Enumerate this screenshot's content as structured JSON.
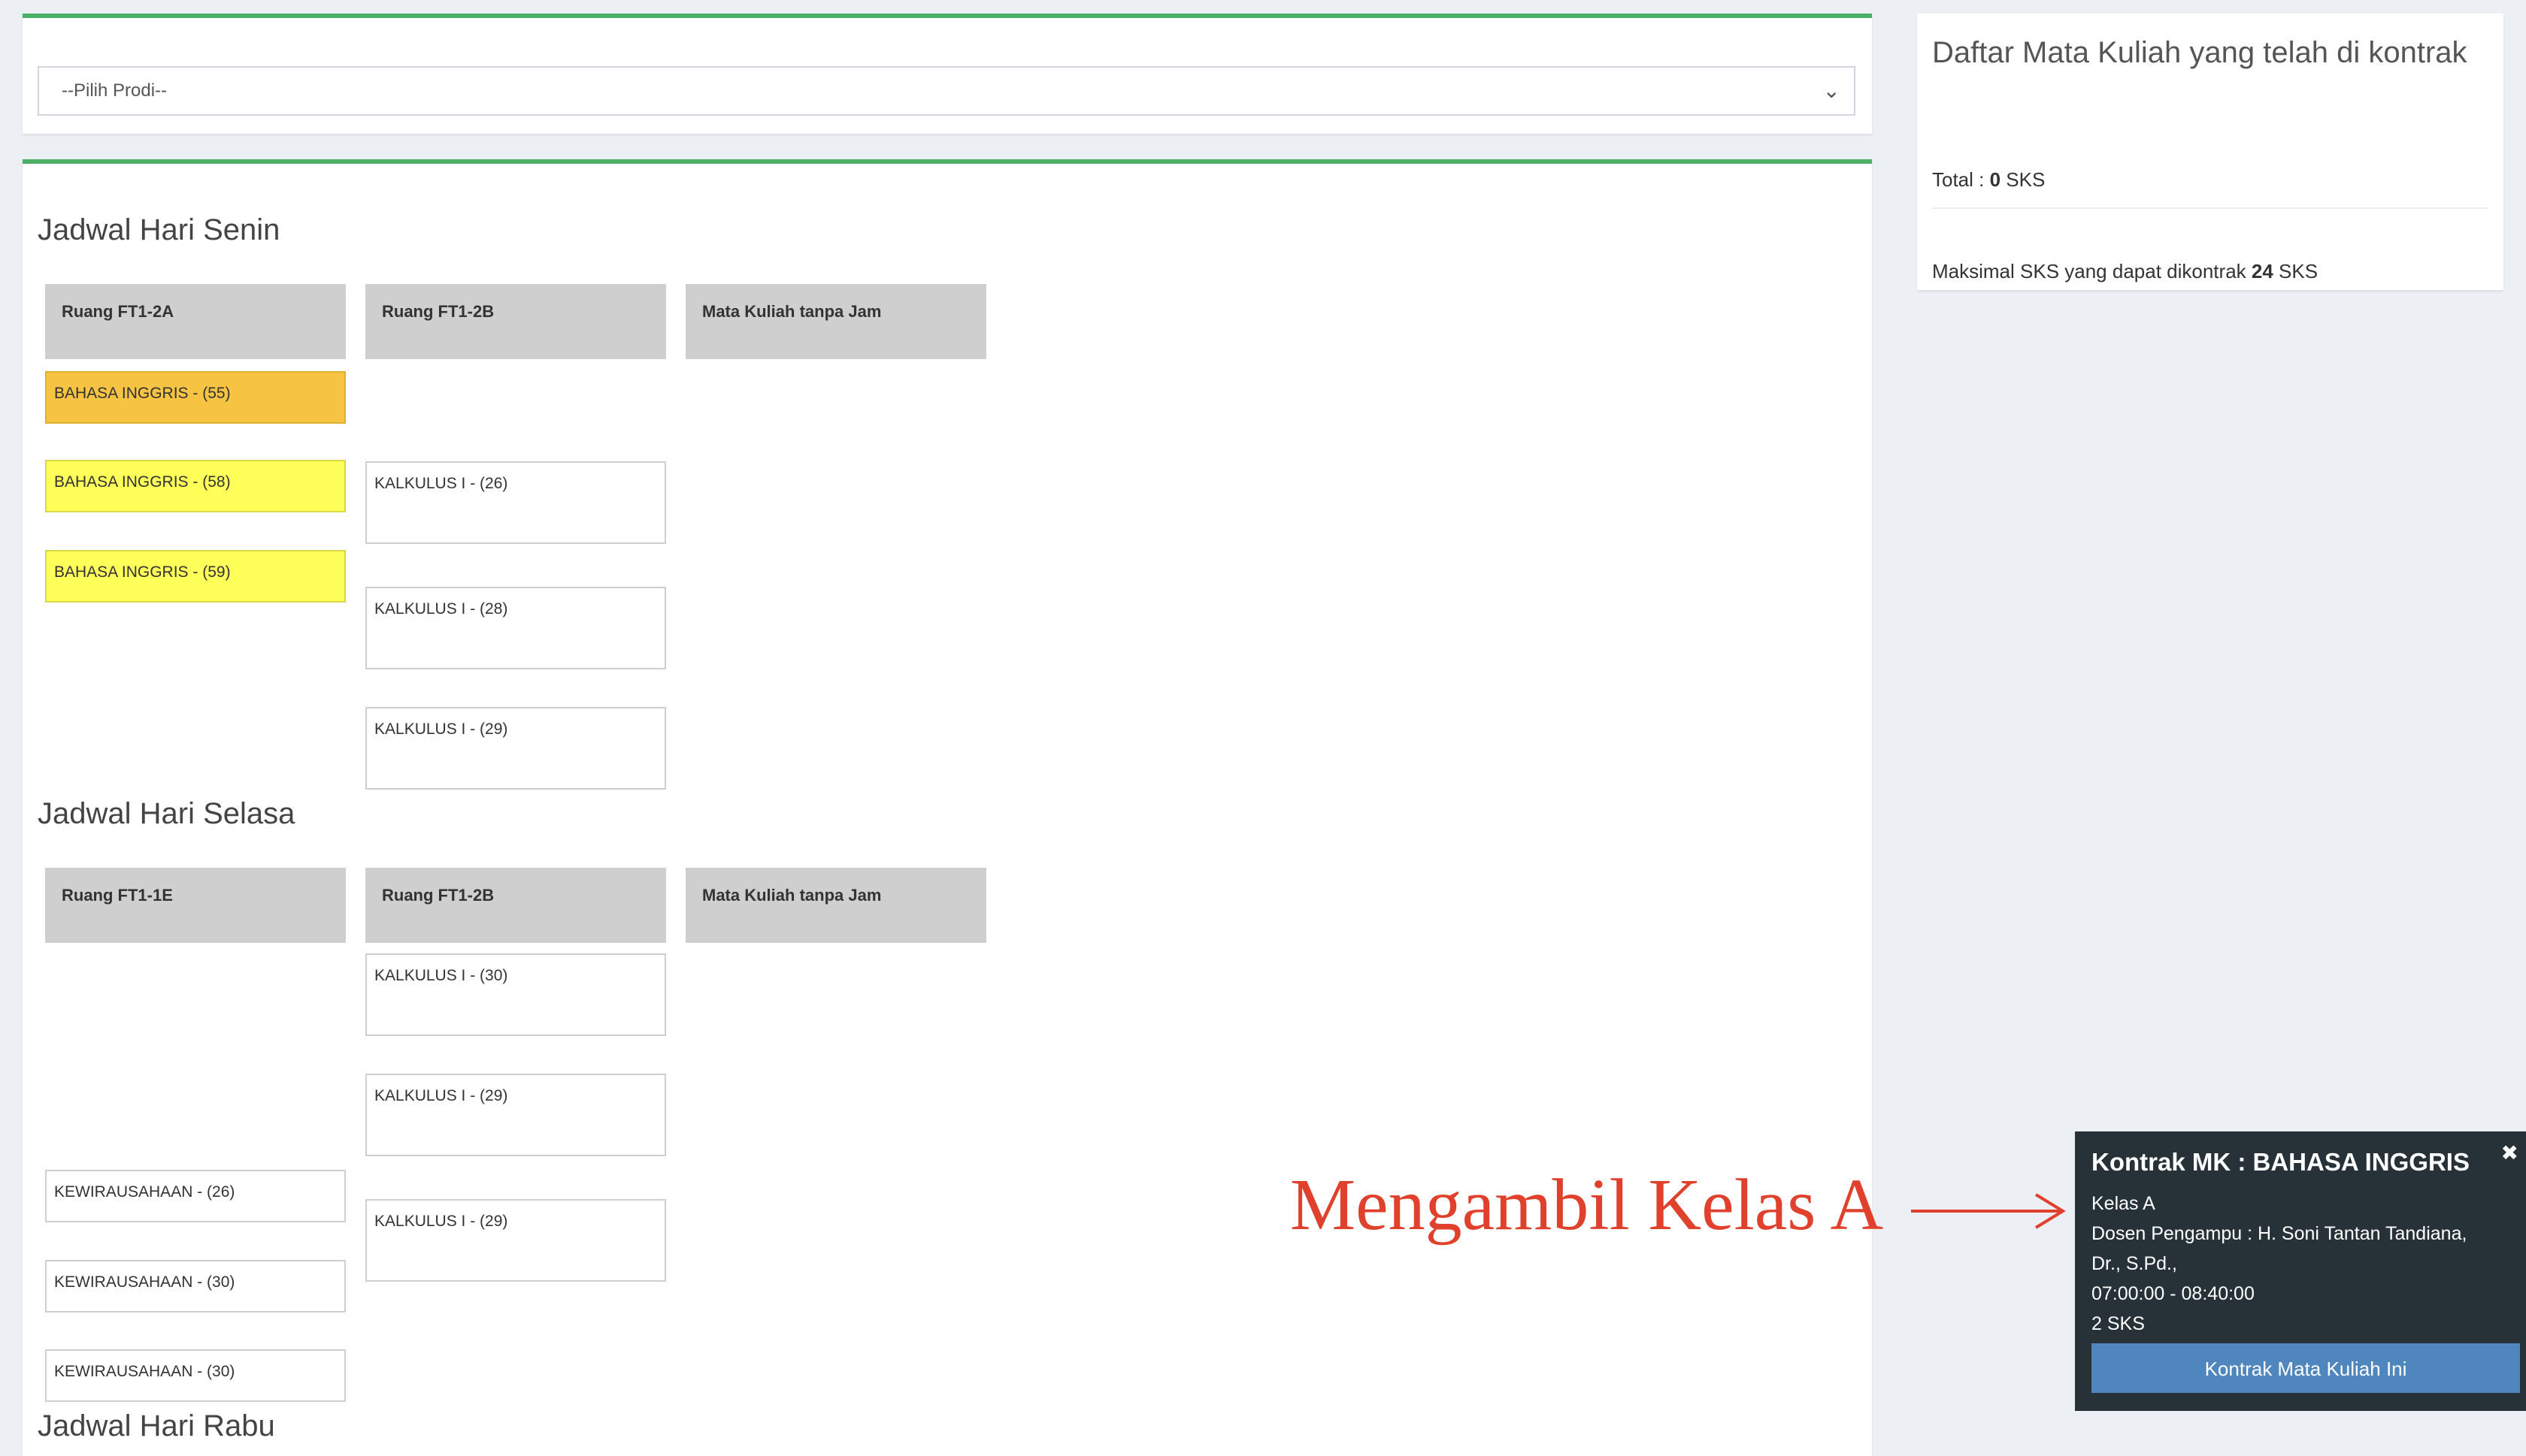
{
  "prodi": {
    "placeholder": "--Pilih Prodi--"
  },
  "senin": {
    "title": "Jadwal Hari Senin",
    "rooms": [
      "Ruang FT1-2A",
      "Ruang FT1-2B",
      "Mata Kuliah tanpa Jam"
    ],
    "col1": [
      "BAHASA INGGRIS - (55)",
      "BAHASA INGGRIS - (58)",
      "BAHASA INGGRIS - (59)"
    ],
    "col2": [
      "KALKULUS I - (26)",
      "KALKULUS I - (28)",
      "KALKULUS I - (29)"
    ]
  },
  "selasa": {
    "title": "Jadwal Hari Selasa",
    "rooms": [
      "Ruang FT1-1E",
      "Ruang FT1-2B",
      "Mata Kuliah tanpa Jam"
    ],
    "col1": [
      "KEWIRAUSAHAAN - (26)",
      "KEWIRAUSAHAAN - (30)",
      "KEWIRAUSAHAAN - (30)"
    ],
    "col2": [
      "KALKULUS I - (30)",
      "KALKULUS I - (29)",
      "KALKULUS I - (29)"
    ]
  },
  "rabu": {
    "title": "Jadwal Hari Rabu"
  },
  "side": {
    "title": "Daftar Mata Kuliah yang telah di kontrak",
    "total_label": "Total : ",
    "total_value": "0",
    "total_unit": " SKS",
    "max_label": "Maksimal SKS yang dapat dikontrak ",
    "max_value": "24",
    "max_unit": " SKS"
  },
  "popover": {
    "title": "Kontrak MK : BAHASA INGGRIS",
    "close": "✖",
    "kelas": "Kelas A",
    "dosen1": "Dosen Pengampu : H. Soni Tantan Tandiana,",
    "dosen2": "Dr., S.Pd.,",
    "time": "07:00:00 - 08:40:00",
    "sks": "2 SKS",
    "button": "Kontrak Mata Kuliah Ini"
  },
  "annotation": {
    "text": "Mengambil Kelas A",
    "color": "#e0412d"
  },
  "colors": {
    "accent_green": "#4caf68",
    "orange_slot": "#f6c342",
    "yellow_slot": "#ffff5a",
    "button_blue": "#4f86bd",
    "popover_bg": "#263238"
  }
}
